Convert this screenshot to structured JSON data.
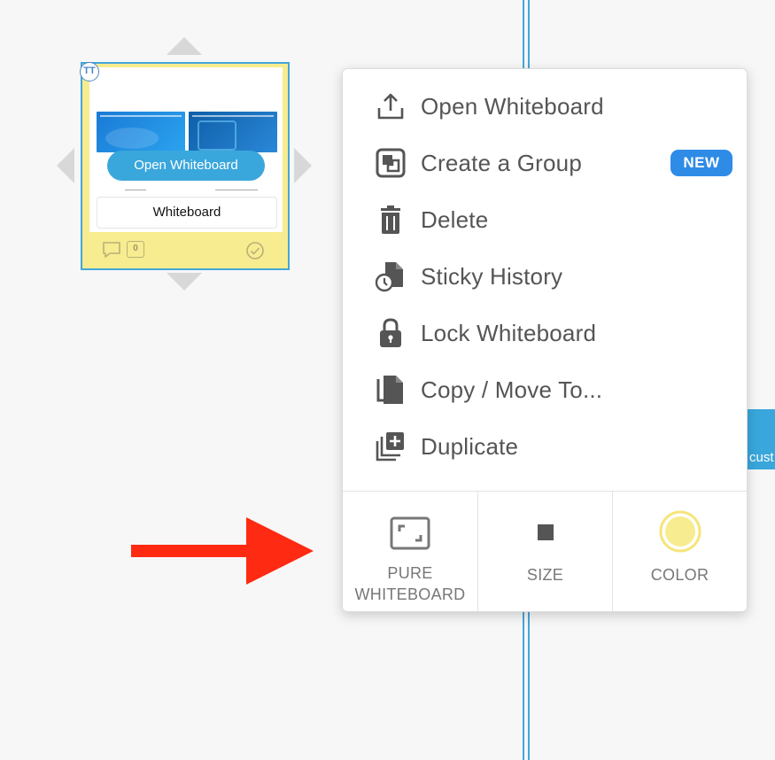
{
  "background": {
    "right_edge_partial_text": "cust"
  },
  "sticky": {
    "avatar_initials": "TT",
    "open_button_label": "Open Whiteboard",
    "title": "Whiteboard",
    "comment_count": "0",
    "color": "#f7ec8f"
  },
  "menu": {
    "items": [
      {
        "icon": "upload-icon",
        "label": "Open Whiteboard"
      },
      {
        "icon": "group-icon",
        "label": "Create a Group",
        "badge": "NEW"
      },
      {
        "icon": "trash-icon",
        "label": "Delete"
      },
      {
        "icon": "history-icon",
        "label": "Sticky History"
      },
      {
        "icon": "lock-icon",
        "label": "Lock Whiteboard"
      },
      {
        "icon": "copy-icon",
        "label": "Copy / Move To..."
      },
      {
        "icon": "duplicate-icon",
        "label": "Duplicate"
      }
    ],
    "bottom": {
      "pure_line1": "PURE",
      "pure_line2": "WHITEBOARD",
      "size": "SIZE",
      "color": "COLOR"
    }
  },
  "colors": {
    "accent": "#3aa7dc",
    "badge": "#2e8be6",
    "annotation_arrow": "#ff2a12",
    "swatch": "#f7ec8f"
  }
}
